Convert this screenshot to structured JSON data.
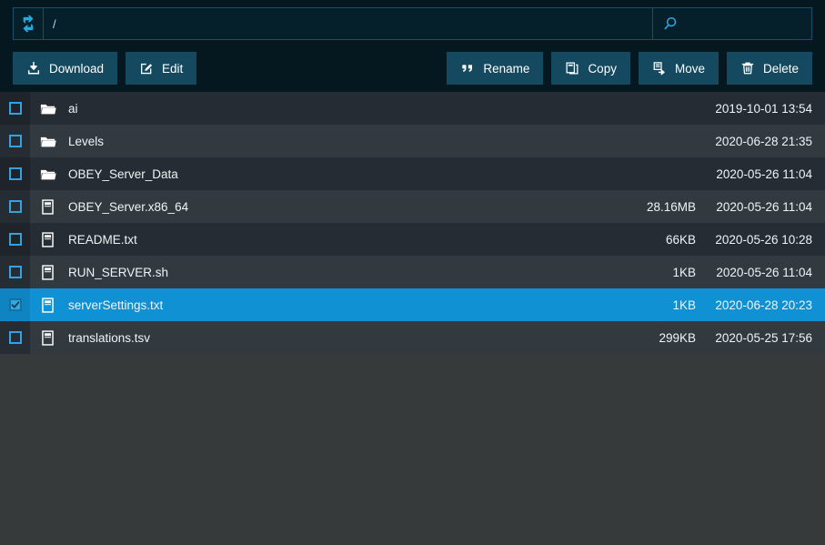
{
  "header": {
    "refresh_icon": "refresh-sync-icon",
    "path_value": "/",
    "path_placeholder": "/",
    "search_icon": "search-icon",
    "search_value": "",
    "search_placeholder": ""
  },
  "toolbar": {
    "left": [
      {
        "label": "Download",
        "icon": "download-icon",
        "name": "download-button"
      },
      {
        "label": "Edit",
        "icon": "edit-pencil-icon",
        "name": "edit-button"
      }
    ],
    "right": [
      {
        "label": "Rename",
        "icon": "quote-icon",
        "name": "rename-button"
      },
      {
        "label": "Copy",
        "icon": "copy-files-icon",
        "name": "copy-button"
      },
      {
        "label": "Move",
        "icon": "move-file-arrow-icon",
        "name": "move-button"
      },
      {
        "label": "Delete",
        "icon": "trash-can-icon",
        "name": "delete-button"
      }
    ]
  },
  "files": [
    {
      "name": "ai",
      "type": "folder",
      "size": "",
      "date": "2019-10-01 13:54",
      "selected": false
    },
    {
      "name": "Levels",
      "type": "folder",
      "size": "",
      "date": "2020-06-28 21:35",
      "selected": false
    },
    {
      "name": "OBEY_Server_Data",
      "type": "folder",
      "size": "",
      "date": "2020-05-26 11:04",
      "selected": false
    },
    {
      "name": "OBEY_Server.x86_64",
      "type": "file",
      "size": "28.16MB",
      "date": "2020-05-26 11:04",
      "selected": false
    },
    {
      "name": "README.txt",
      "type": "file",
      "size": "66KB",
      "date": "2020-05-26 10:28",
      "selected": false
    },
    {
      "name": "RUN_SERVER.sh",
      "type": "file",
      "size": "1KB",
      "date": "2020-05-26 11:04",
      "selected": false
    },
    {
      "name": "serverSettings.txt",
      "type": "file",
      "size": "1KB",
      "date": "2020-06-28 20:23",
      "selected": true
    },
    {
      "name": "translations.tsv",
      "type": "file",
      "size": "299KB",
      "date": "2020-05-25 17:56",
      "selected": false
    }
  ],
  "colors": {
    "header_bg": "#06181f",
    "button_bg": "#15495f",
    "accent": "#1091d4",
    "row_odd": "#262c33",
    "row_even": "#323a40",
    "page_bg": "#373a3a",
    "icon_blue": "#29a8e0"
  }
}
